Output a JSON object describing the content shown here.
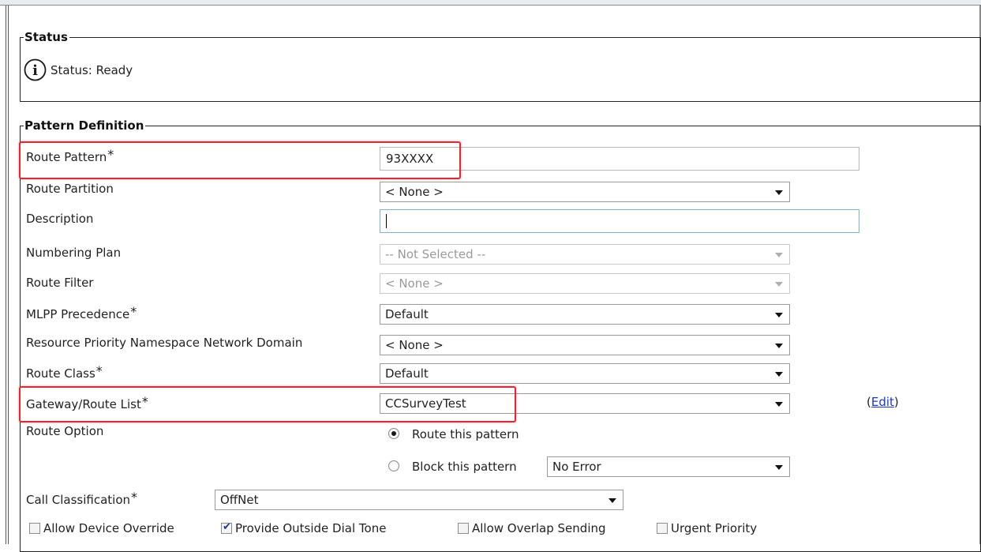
{
  "status_section": {
    "legend": "Status",
    "icon": "info-icon",
    "text": "Status: Ready"
  },
  "pattern_section": {
    "legend": "Pattern Definition",
    "route_pattern": {
      "label": "Route Pattern",
      "required": "*",
      "value": "93XXXX"
    },
    "route_partition": {
      "label": "Route Partition",
      "value": "< None >"
    },
    "description": {
      "label": "Description",
      "value": ""
    },
    "numbering_plan": {
      "label": "Numbering Plan",
      "value": "-- Not Selected --"
    },
    "route_filter": {
      "label": "Route Filter",
      "value": "< None >"
    },
    "mlpp_precedence": {
      "label": "MLPP Precedence",
      "required": "*",
      "value": "Default"
    },
    "resource_priority": {
      "label": "Resource Priority Namespace Network Domain",
      "value": "< None >"
    },
    "route_class": {
      "label": "Route Class",
      "required": "*",
      "value": "Default"
    },
    "gateway_route_list": {
      "label": "Gateway/Route List",
      "required": "*",
      "value": "CCSurveyTest",
      "edit_open": "(",
      "edit_link": "Edit",
      "edit_close": ")"
    },
    "route_option": {
      "label": "Route Option",
      "route_this": "Route this pattern",
      "block_this": "Block this pattern",
      "block_reason": "No Error",
      "selected": "route"
    },
    "call_classification": {
      "label": "Call Classification",
      "required": "*",
      "value": "OffNet"
    },
    "checkboxes": {
      "allow_device_override": {
        "label": "Allow Device Override",
        "checked": false
      },
      "provide_outside_dial_tone": {
        "label": "Provide Outside Dial Tone",
        "checked": true
      },
      "allow_overlap_sending": {
        "label": "Allow Overlap Sending",
        "checked": false
      },
      "urgent_priority": {
        "label": "Urgent Priority",
        "checked": false
      }
    }
  },
  "colors": {
    "highlight": "#e8262f",
    "link": "#1a37c9",
    "focus_border": "#7db1d6"
  }
}
